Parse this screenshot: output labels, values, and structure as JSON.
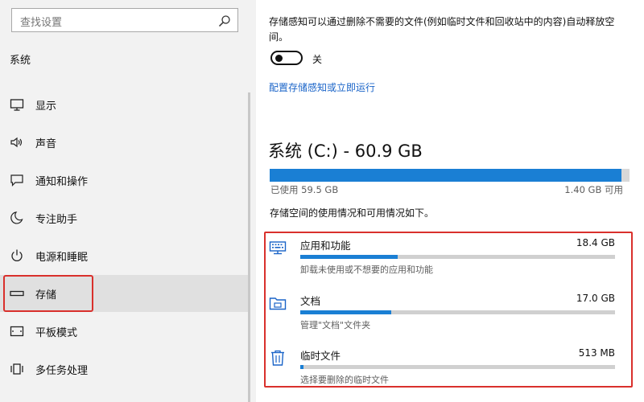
{
  "sidebar": {
    "search_placeholder": "查找设置",
    "section_title": "系统",
    "items": [
      {
        "label": "显示",
        "icon": "monitor-icon"
      },
      {
        "label": "声音",
        "icon": "speaker-icon"
      },
      {
        "label": "通知和操作",
        "icon": "notification-icon"
      },
      {
        "label": "专注助手",
        "icon": "moon-icon"
      },
      {
        "label": "电源和睡眠",
        "icon": "power-icon"
      },
      {
        "label": "存储",
        "icon": "storage-icon",
        "selected": true
      },
      {
        "label": "平板模式",
        "icon": "tablet-icon"
      },
      {
        "label": "多任务处理",
        "icon": "multitask-icon"
      }
    ]
  },
  "content": {
    "description": "存储感知可以通过删除不需要的文件(例如临时文件和回收站中的内容)自动释放空间。",
    "toggle": {
      "label": "关",
      "on": false
    },
    "config_link": "配置存储感知或立即运行",
    "drive": {
      "title": "系统 (C:) - 60.9 GB",
      "used_label": "已使用 59.5 GB",
      "free_label": "1.40 GB 可用",
      "used_fraction": 0.977
    },
    "usage_intro": "存储空间的使用情况和可用情况如下。",
    "categories": [
      {
        "name": "应用和功能",
        "size": "18.4 GB",
        "desc": "卸载未使用或不想要的应用和功能",
        "fraction": 0.31,
        "icon": "apps-icon"
      },
      {
        "name": "文档",
        "size": "17.0 GB",
        "desc": "管理\"文档\"文件夹",
        "fraction": 0.29,
        "icon": "folder-icon"
      },
      {
        "name": "临时文件",
        "size": "513 MB",
        "desc": "选择要删除的临时文件",
        "fraction": 0.01,
        "icon": "trash-icon"
      }
    ]
  },
  "colors": {
    "accent": "#1a7fd4",
    "highlight_border": "#d9302c",
    "link": "#1a64c8"
  }
}
